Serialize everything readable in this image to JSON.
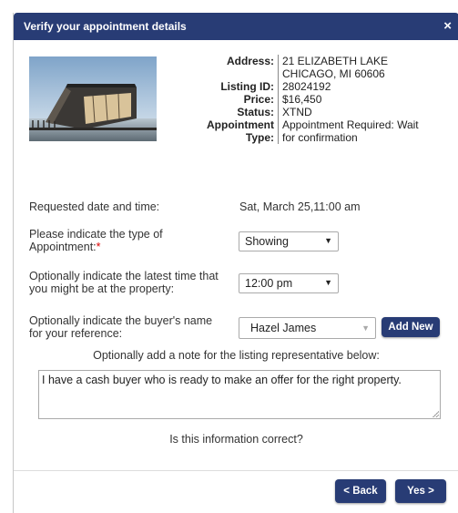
{
  "dialog": {
    "title": "Verify your appointment details",
    "close_icon": "×"
  },
  "listing": {
    "address_label": "Address:",
    "address_line1": "21 ELIZABETH LAKE",
    "address_line2": "CHICAGO, MI 60606",
    "listing_id_label": "Listing ID:",
    "listing_id": "28024192",
    "price_label": "Price:",
    "price": "$16,450",
    "status_label": "Status:",
    "status": "XTND",
    "appt_type_label1": "Appointment",
    "appt_type_label2": "Type:",
    "appt_type_line1": "Appointment Required: Wait",
    "appt_type_line2": "for confirmation"
  },
  "form": {
    "requested_label": "Requested date and time:",
    "requested_value": "Sat, March 25,11:00 am",
    "type_label_line1": "Please indicate the type of",
    "type_label_line2": "Appointment:",
    "required_mark": "*",
    "type_value": "Showing",
    "latest_label_line1": "Optionally indicate the latest time that",
    "latest_label_line2": "you might be at the property:",
    "latest_value": "12:00 pm",
    "buyer_label_line1": "Optionally indicate the buyer's name",
    "buyer_label_line2": "for your reference:",
    "buyer_value": "Hazel James",
    "add_new_label": "Add New",
    "note_label": "Optionally add a note for the listing representative below:",
    "note_value": "I have a cash buyer who is ready to make an offer for the right property.",
    "confirm_question": "Is this information correct?"
  },
  "buttons": {
    "back_label": "< Back",
    "yes_label": "Yes >"
  },
  "icons": {
    "dropdown_arrow": "▼"
  },
  "colors": {
    "titlebar": "#283c75",
    "button": "#283c75",
    "required": "#dd0000"
  }
}
